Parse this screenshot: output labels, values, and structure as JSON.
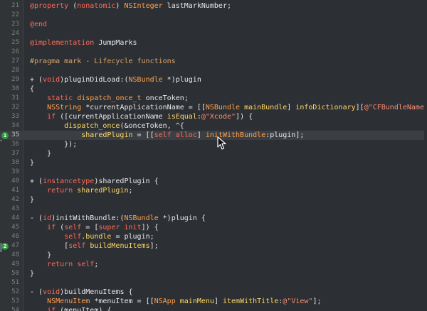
{
  "colors": {
    "background": "#2c2f33",
    "keyword": "#ff6b5a",
    "type": "#ffa14f",
    "string": "#ff8c70",
    "method": "#ffd866",
    "preprocessor": "#d9a56b",
    "comment": "#bfc2c4",
    "default": "#e8e8e8",
    "line_number": "#7c8084",
    "breakpoint": "#2e9a3e"
  },
  "lines": [
    {
      "n": "21",
      "segs": [
        [
          "kw",
          "@property"
        ],
        [
          "pl",
          " ("
        ],
        [
          "kw",
          "nonatomic"
        ],
        [
          "pl",
          ") "
        ],
        [
          "ty",
          "NSInteger"
        ],
        [
          "pl",
          " lastMarkNumber;"
        ]
      ]
    },
    {
      "n": "22",
      "segs": []
    },
    {
      "n": "23",
      "segs": [
        [
          "kw",
          "@end"
        ]
      ]
    },
    {
      "n": "24",
      "segs": []
    },
    {
      "n": "25",
      "segs": [
        [
          "kw",
          "@implementation"
        ],
        [
          "pl",
          " JumpMarks"
        ]
      ]
    },
    {
      "n": "26",
      "segs": []
    },
    {
      "n": "27",
      "segs": [
        [
          "pp",
          "#pragma mark - Lifecycle functions"
        ]
      ]
    },
    {
      "n": "28",
      "segs": []
    },
    {
      "n": "29",
      "segs": [
        [
          "pl",
          "+ ("
        ],
        [
          "kw",
          "void"
        ],
        [
          "pl",
          ")pluginDidLoad:("
        ],
        [
          "ty",
          "NSBundle"
        ],
        [
          "pl",
          " *)plugin"
        ]
      ]
    },
    {
      "n": "30",
      "segs": [
        [
          "pl",
          "{"
        ]
      ]
    },
    {
      "n": "31",
      "segs": [
        [
          "pl",
          "    "
        ],
        [
          "kw",
          "static"
        ],
        [
          "pl",
          " "
        ],
        [
          "ty",
          "dispatch_once_t"
        ],
        [
          "pl",
          " onceToken;"
        ]
      ]
    },
    {
      "n": "32",
      "segs": [
        [
          "pl",
          "    "
        ],
        [
          "ty",
          "NSString"
        ],
        [
          "pl",
          " *currentApplicationName = [["
        ],
        [
          "ty",
          "NSBundle"
        ],
        [
          "pl",
          " "
        ],
        [
          "me",
          "mainBundle"
        ],
        [
          "pl",
          "] "
        ],
        [
          "me",
          "infoDictionary"
        ],
        [
          "pl",
          "]["
        ],
        [
          "st",
          "@\"CFBundleName\""
        ],
        [
          "pl",
          "];"
        ]
      ]
    },
    {
      "n": "33",
      "segs": [
        [
          "pl",
          "    "
        ],
        [
          "kw",
          "if"
        ],
        [
          "pl",
          " ([currentApplicationName "
        ],
        [
          "me",
          "isEqual"
        ],
        [
          "pl",
          ":"
        ],
        [
          "st",
          "@\"Xcode\""
        ],
        [
          "pl",
          "]) {"
        ]
      ]
    },
    {
      "n": "34",
      "segs": [
        [
          "pl",
          "        "
        ],
        [
          "me",
          "dispatch_once"
        ],
        [
          "pl",
          "(&onceToken, ^{"
        ]
      ]
    },
    {
      "n": "35",
      "current": true,
      "bp": "1",
      "segs": [
        [
          "pl",
          "            "
        ],
        [
          "me",
          "sharedPlugin"
        ],
        [
          "pl",
          " = [["
        ],
        [
          "kw",
          "self"
        ],
        [
          "pl",
          " "
        ],
        [
          "kw",
          "alloc"
        ],
        [
          "pl",
          "] "
        ],
        [
          "ty",
          "initWithBundle"
        ],
        [
          "pl",
          ":plugin];"
        ]
      ]
    },
    {
      "n": "36",
      "segs": [
        [
          "pl",
          "        });"
        ]
      ]
    },
    {
      "n": "37",
      "segs": [
        [
          "pl",
          "    }"
        ]
      ]
    },
    {
      "n": "38",
      "segs": [
        [
          "pl",
          "}"
        ]
      ]
    },
    {
      "n": "39",
      "segs": []
    },
    {
      "n": "40",
      "segs": [
        [
          "pl",
          "+ ("
        ],
        [
          "kw",
          "instancetype"
        ],
        [
          "pl",
          ")sharedPlugin {"
        ]
      ]
    },
    {
      "n": "41",
      "segs": [
        [
          "pl",
          "    "
        ],
        [
          "kw",
          "return"
        ],
        [
          "pl",
          " "
        ],
        [
          "me",
          "sharedPlugin"
        ],
        [
          "pl",
          ";"
        ]
      ]
    },
    {
      "n": "42",
      "segs": [
        [
          "pl",
          "}"
        ]
      ]
    },
    {
      "n": "43",
      "segs": []
    },
    {
      "n": "44",
      "segs": [
        [
          "pl",
          "- ("
        ],
        [
          "kw",
          "id"
        ],
        [
          "pl",
          ")initWithBundle:("
        ],
        [
          "ty",
          "NSBundle"
        ],
        [
          "pl",
          " *)plugin {"
        ]
      ]
    },
    {
      "n": "45",
      "segs": [
        [
          "pl",
          "    "
        ],
        [
          "kw",
          "if"
        ],
        [
          "pl",
          " ("
        ],
        [
          "kw",
          "self"
        ],
        [
          "pl",
          " = ["
        ],
        [
          "kw",
          "super"
        ],
        [
          "pl",
          " "
        ],
        [
          "kw",
          "init"
        ],
        [
          "pl",
          "]) {"
        ]
      ]
    },
    {
      "n": "46",
      "segs": [
        [
          "pl",
          "        "
        ],
        [
          "kw",
          "self"
        ],
        [
          "pl",
          "."
        ],
        [
          "me",
          "bundle"
        ],
        [
          "pl",
          " = plugin;"
        ]
      ]
    },
    {
      "n": "47",
      "bp": "2",
      "segs": [
        [
          "pl",
          "        ["
        ],
        [
          "kw",
          "self"
        ],
        [
          "pl",
          " "
        ],
        [
          "me",
          "buildMenuItems"
        ],
        [
          "pl",
          "];"
        ]
      ]
    },
    {
      "n": "48",
      "segs": [
        [
          "pl",
          "    }"
        ]
      ]
    },
    {
      "n": "49",
      "segs": [
        [
          "pl",
          "    "
        ],
        [
          "kw",
          "return"
        ],
        [
          "pl",
          " "
        ],
        [
          "kw",
          "self"
        ],
        [
          "pl",
          ";"
        ]
      ]
    },
    {
      "n": "50",
      "segs": [
        [
          "pl",
          "}"
        ]
      ]
    },
    {
      "n": "51",
      "segs": []
    },
    {
      "n": "52",
      "segs": [
        [
          "pl",
          "- ("
        ],
        [
          "kw",
          "void"
        ],
        [
          "pl",
          ")buildMenuItems {"
        ]
      ]
    },
    {
      "n": "53",
      "segs": [
        [
          "pl",
          "    "
        ],
        [
          "ty",
          "NSMenuItem"
        ],
        [
          "pl",
          " *menuItem = [["
        ],
        [
          "ty",
          "NSApp"
        ],
        [
          "pl",
          " "
        ],
        [
          "me",
          "mainMenu"
        ],
        [
          "pl",
          "] "
        ],
        [
          "me",
          "itemWithTitle"
        ],
        [
          "pl",
          ":"
        ],
        [
          "st",
          "@\"View\""
        ],
        [
          "pl",
          "];"
        ]
      ]
    },
    {
      "n": "54",
      "segs": [
        [
          "pl",
          "    "
        ],
        [
          "kw",
          "if"
        ],
        [
          "pl",
          " (menuItem) {"
        ]
      ]
    }
  ]
}
